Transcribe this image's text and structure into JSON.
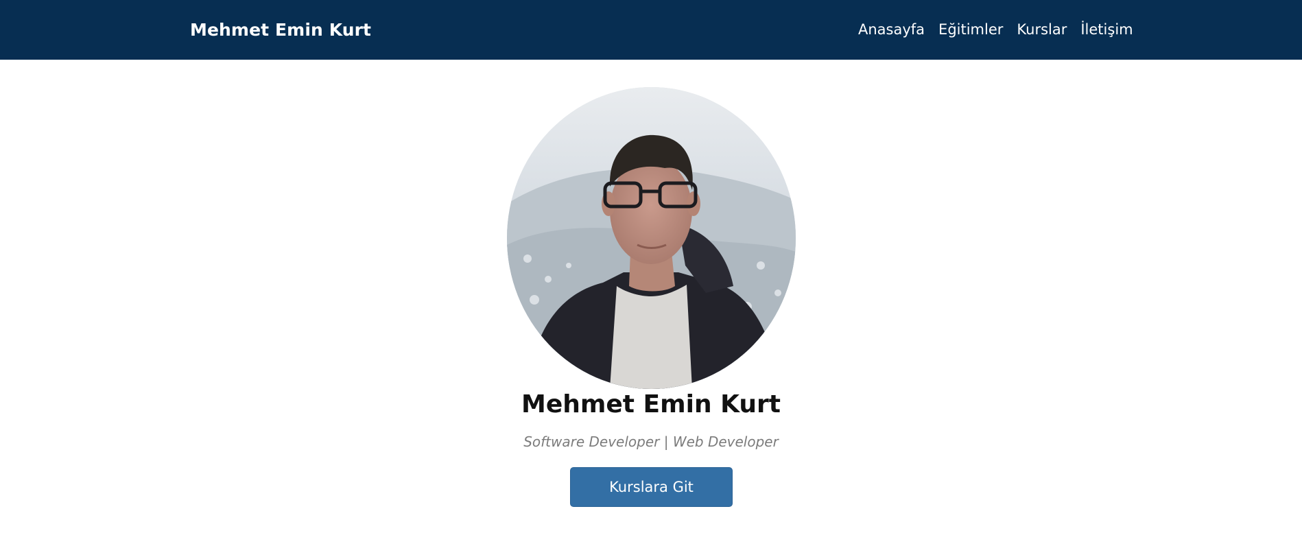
{
  "navbar": {
    "brand": "Mehmet Emin Kurt",
    "links": [
      {
        "label": "Anasayfa"
      },
      {
        "label": "Eğitimler"
      },
      {
        "label": "Kurslar"
      },
      {
        "label": "İletişim"
      }
    ]
  },
  "profile": {
    "photo_alt": "Mehmet Emin Kurt",
    "name": "Mehmet Emin Kurt",
    "subtitle": "Software Developer | Web Developer",
    "cta_label": "Kurslara Git"
  },
  "colors": {
    "navbar_bg": "#072e52",
    "button_bg": "#336fa5",
    "subtitle_text": "#7b7b7b"
  }
}
